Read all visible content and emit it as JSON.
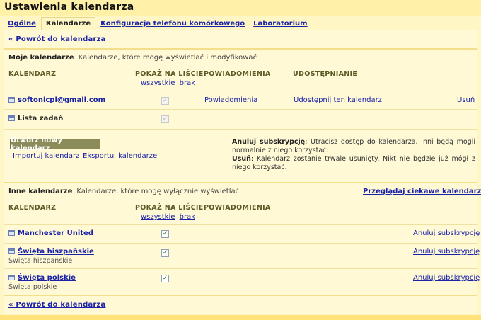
{
  "title": "Ustawienia kalendarza",
  "tabs": [
    "Ogólne",
    "Kalendarze",
    "Konfiguracja telefonu komórkowego",
    "Laboratorium"
  ],
  "back_link": "« Powrót do kalendarza",
  "my_calendars": {
    "title": "Moje kalendarze",
    "desc": "Kalendarze, które mogę wyświetlać i modyfikować",
    "headers": {
      "calendar": "KALENDARZ",
      "show": "POKAŻ NA LIŚCIE",
      "all": "wszystkie",
      "none": "brak",
      "notifications": "POWIADOMIENIA",
      "sharing": "UDOSTĘPNIANIE"
    },
    "rows": [
      {
        "name": "softonicpl@gmail.com",
        "checked": true,
        "notifications": "Powiadomienia",
        "share": "Udostępnij ten kalendarz",
        "delete": "Usuń"
      },
      {
        "name": "Lista zadań",
        "checked": true
      }
    ],
    "create_button": "Utwórz nowy kalendarz",
    "import_link": "Importuj kalendarz",
    "export_link": "Eksportuj kalendarze",
    "info": {
      "unsub_label": "Anuluj subskrypcję",
      "unsub_text": ": Utracisz dostęp do kalendarza. Inni będą mogli normalnie z niego korzystać.",
      "delete_label": "Usuń",
      "delete_text": ": Kalendarz zostanie trwale usunięty. Nikt nie będzie już mógł z niego korzystać."
    }
  },
  "other_calendars": {
    "title": "Inne kalendarze",
    "desc": "Kalendarze, które mogę wyłącznie wyświetlać",
    "browse_link": "Przeglądaj ciekawe kalendarze »",
    "headers": {
      "calendar": "KALENDARZ",
      "show": "POKAŻ NA LIŚCIE",
      "all": "wszystkie",
      "none": "brak",
      "notifications": "POWIADOMIENIA"
    },
    "rows": [
      {
        "name": "Manchester United",
        "sub": "",
        "checked": true,
        "action": "Anuluj subskrypcję"
      },
      {
        "name": "Święta hiszpańskie",
        "sub": "Święta hiszpańskie",
        "checked": true,
        "action": "Anuluj subskrypcję"
      },
      {
        "name": "Święta polskie",
        "sub": "Święta polskie",
        "checked": true,
        "action": "Anuluj subskrypcję"
      }
    ]
  },
  "colors": {
    "panel": "#fff9d6",
    "title_bar": "#fff1a8",
    "link": "#1a22a8",
    "button": "#8c8c5a"
  }
}
